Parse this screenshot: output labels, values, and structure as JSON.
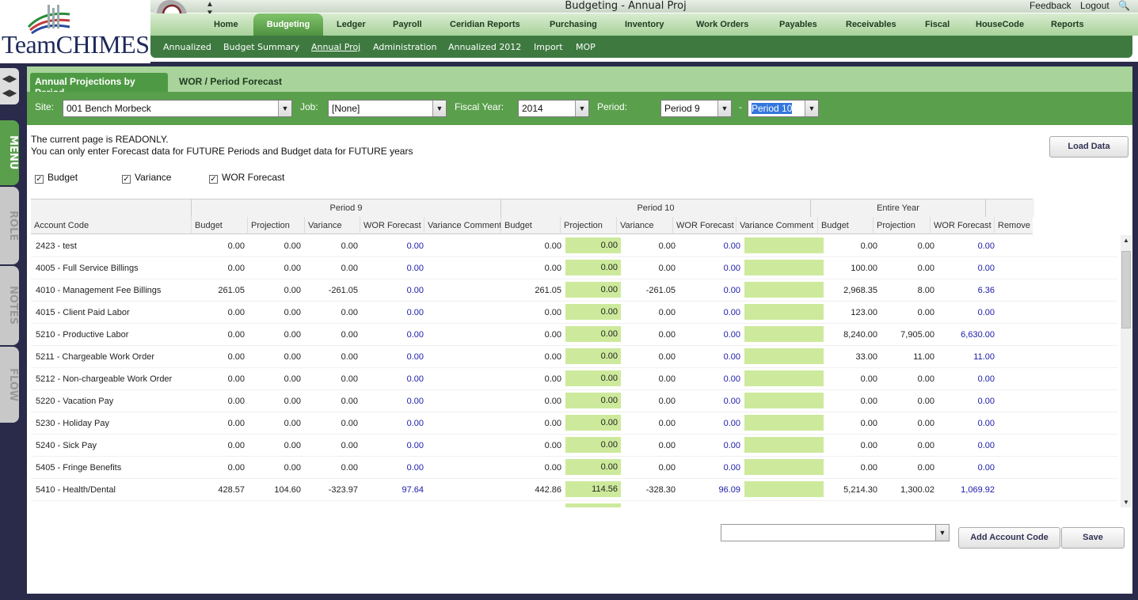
{
  "app": {
    "title": "Budgeting - Annual Proj",
    "logo_text": "TeamCHIMES"
  },
  "top_links": {
    "feedback": "Feedback",
    "logout": "Logout"
  },
  "main_nav": [
    "Home",
    "Budgeting",
    "Ledger",
    "Payroll",
    "Ceridian Reports",
    "Purchasing",
    "Inventory",
    "Work Orders",
    "Payables",
    "Receivables",
    "Fiscal",
    "HouseCode",
    "Reports"
  ],
  "main_nav_active": "Budgeting",
  "sub_nav": [
    "Annualized",
    "Budget Summary",
    "Annual Proj",
    "Administration",
    "Annualized 2012",
    "Import",
    "MOP"
  ],
  "sub_nav_active": "Annual Proj",
  "side_tabs": [
    "MENU",
    "ROLE",
    "NOTES",
    "FLOW"
  ],
  "tabs": {
    "active": "Annual Projections by Period",
    "second": "WOR / Period Forecast"
  },
  "filters": {
    "site_label": "Site:",
    "site_value": "001 Bench Morbeck",
    "job_label": "Job:",
    "job_value": "[None]",
    "fy_label": "Fiscal Year:",
    "fy_value": "2014",
    "period_label": "Period:",
    "period_from": "Period 9",
    "period_sep": "-",
    "period_to": "Period 10"
  },
  "notice": {
    "line1": "The current page is READONLY.",
    "line2": "You can only enter Forecast data for FUTURE Periods and Budget data for FUTURE years"
  },
  "load_button": "Load Data",
  "checkboxes": {
    "budget": "Budget",
    "variance": "Variance",
    "wor": "WOR Forecast"
  },
  "grid": {
    "groups": {
      "p9": "Period 9",
      "p10": "Period 10",
      "year": "Entire Year"
    },
    "columns": [
      "Account Code",
      "Budget",
      "Projection",
      "Variance",
      "WOR Forecast",
      "Variance Comment",
      "Budget",
      "Projection",
      "Variance",
      "WOR Forecast",
      "Variance Comment",
      "Budget",
      "Projection",
      "WOR Forecast",
      "Remove"
    ],
    "rows": [
      {
        "acct": "2423 - test",
        "p9b": "0.00",
        "p9p": "0.00",
        "p9v": "0.00",
        "p9w": "0.00",
        "p10b": "0.00",
        "p10p": "0.00",
        "p10v": "0.00",
        "p10w": "0.00",
        "yb": "0.00",
        "yp": "0.00",
        "yw": "0.00"
      },
      {
        "acct": "4005 - Full Service Billings",
        "p9b": "0.00",
        "p9p": "0.00",
        "p9v": "0.00",
        "p9w": "0.00",
        "p10b": "0.00",
        "p10p": "0.00",
        "p10v": "0.00",
        "p10w": "0.00",
        "yb": "100.00",
        "yp": "0.00",
        "yw": "0.00"
      },
      {
        "acct": "4010 - Management Fee Billings",
        "p9b": "261.05",
        "p9p": "0.00",
        "p9v": "-261.05",
        "p9w": "0.00",
        "p10b": "261.05",
        "p10p": "0.00",
        "p10v": "-261.05",
        "p10w": "0.00",
        "yb": "2,968.35",
        "yp": "8.00",
        "yw": "6.36"
      },
      {
        "acct": "4015 - Client Paid Labor",
        "p9b": "0.00",
        "p9p": "0.00",
        "p9v": "0.00",
        "p9w": "0.00",
        "p10b": "0.00",
        "p10p": "0.00",
        "p10v": "0.00",
        "p10w": "0.00",
        "yb": "123.00",
        "yp": "0.00",
        "yw": "0.00"
      },
      {
        "acct": "5210 - Productive Labor",
        "p9b": "0.00",
        "p9p": "0.00",
        "p9v": "0.00",
        "p9w": "0.00",
        "p10b": "0.00",
        "p10p": "0.00",
        "p10v": "0.00",
        "p10w": "0.00",
        "yb": "8,240.00",
        "yp": "7,905.00",
        "yw": "6,630.00"
      },
      {
        "acct": "5211 - Chargeable Work Order",
        "p9b": "0.00",
        "p9p": "0.00",
        "p9v": "0.00",
        "p9w": "0.00",
        "p10b": "0.00",
        "p10p": "0.00",
        "p10v": "0.00",
        "p10w": "0.00",
        "yb": "33.00",
        "yp": "11.00",
        "yw": "11.00"
      },
      {
        "acct": "5212 - Non-chargeable Work Order",
        "p9b": "0.00",
        "p9p": "0.00",
        "p9v": "0.00",
        "p9w": "0.00",
        "p10b": "0.00",
        "p10p": "0.00",
        "p10v": "0.00",
        "p10w": "0.00",
        "yb": "0.00",
        "yp": "0.00",
        "yw": "0.00"
      },
      {
        "acct": "5220 - Vacation Pay",
        "p9b": "0.00",
        "p9p": "0.00",
        "p9v": "0.00",
        "p9w": "0.00",
        "p10b": "0.00",
        "p10p": "0.00",
        "p10v": "0.00",
        "p10w": "0.00",
        "yb": "0.00",
        "yp": "0.00",
        "yw": "0.00"
      },
      {
        "acct": "5230 - Holiday Pay",
        "p9b": "0.00",
        "p9p": "0.00",
        "p9v": "0.00",
        "p9w": "0.00",
        "p10b": "0.00",
        "p10p": "0.00",
        "p10v": "0.00",
        "p10w": "0.00",
        "yb": "0.00",
        "yp": "0.00",
        "yw": "0.00"
      },
      {
        "acct": "5240 - Sick Pay",
        "p9b": "0.00",
        "p9p": "0.00",
        "p9v": "0.00",
        "p9w": "0.00",
        "p10b": "0.00",
        "p10p": "0.00",
        "p10v": "0.00",
        "p10w": "0.00",
        "yb": "0.00",
        "yp": "0.00",
        "yw": "0.00"
      },
      {
        "acct": "5405 - Fringe Benefits",
        "p9b": "0.00",
        "p9p": "0.00",
        "p9v": "0.00",
        "p9w": "0.00",
        "p10b": "0.00",
        "p10p": "0.00",
        "p10v": "0.00",
        "p10w": "0.00",
        "yb": "0.00",
        "yp": "0.00",
        "yw": "0.00"
      },
      {
        "acct": "5410 - Health/Dental",
        "p9b": "428.57",
        "p9p": "104.60",
        "p9v": "-323.97",
        "p9w": "97.64",
        "p10b": "442.86",
        "p10p": "114.56",
        "p10v": "-328.30",
        "p10w": "96.09",
        "yb": "5,214.30",
        "yp": "1,300.02",
        "yw": "1,069.92"
      }
    ]
  },
  "footer": {
    "add_button": "Add Account Code",
    "save_button": "Save"
  },
  "colors": {
    "nav_green": "#3e7a40",
    "tab_green": "#4e9a44",
    "input_green": "#cdea9c",
    "forecast_blue": "#1a1aaa"
  }
}
